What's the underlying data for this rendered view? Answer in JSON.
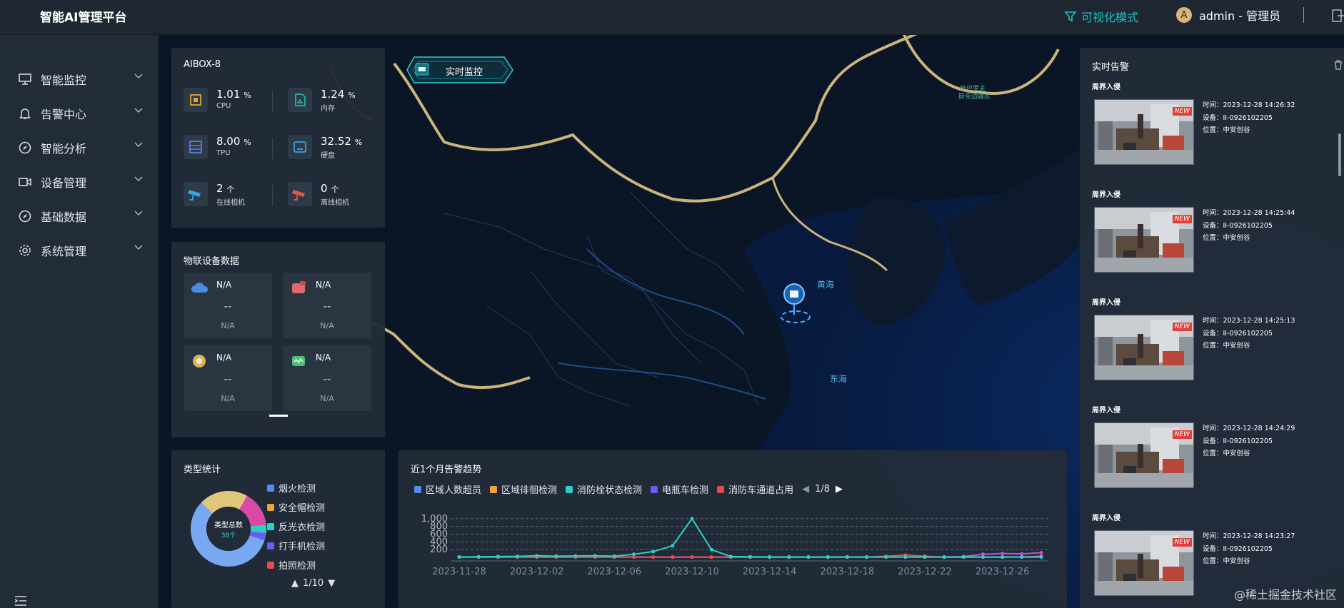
{
  "app": {
    "title": "智能AI管理平台",
    "mode_label": "可视化模式",
    "user_initial": "A",
    "user_label": "admin - 管理员"
  },
  "nav": [
    {
      "label": "智能监控",
      "icon": "monitor-icon"
    },
    {
      "label": "告警中心",
      "icon": "bell-icon"
    },
    {
      "label": "智能分析",
      "icon": "compass-icon"
    },
    {
      "label": "设备管理",
      "icon": "camera-icon"
    },
    {
      "label": "基础数据",
      "icon": "compass-icon"
    },
    {
      "label": "系统管理",
      "icon": "gear-icon"
    }
  ],
  "live_button": "实时监控",
  "map_labels": {
    "yellow_sea": "黄海",
    "east_sea": "东海",
    "border": "哈巴罗夫\n斯克边疆区"
  },
  "aibox": {
    "title": "AIBOX-8",
    "stats": [
      {
        "value": "1.01",
        "unit": "%",
        "label": "CPU",
        "icon": "cpu-icon",
        "color": "#e0a236"
      },
      {
        "value": "1.24",
        "unit": "%",
        "label": "内存",
        "icon": "memory-icon",
        "color": "#2bb39a"
      },
      {
        "value": "8.00",
        "unit": "%",
        "label": "TPU",
        "icon": "tpu-icon",
        "color": "#5b7fe6"
      },
      {
        "value": "32.52",
        "unit": "%",
        "label": "硬盘",
        "icon": "disk-icon",
        "color": "#3aa3e0"
      },
      {
        "value": "2",
        "unit": "个",
        "label": "在线相机",
        "icon": "online-camera-icon",
        "color": "#3aa3e0"
      },
      {
        "value": "0",
        "unit": "个",
        "label": "离线相机",
        "icon": "offline-camera-icon",
        "color": "#e05a4a"
      }
    ]
  },
  "iot": {
    "title": "物联设备数据",
    "cards": [
      {
        "name": "N/A",
        "value": "--",
        "sub": "N/A",
        "icon": "cloud-icon",
        "color": "#4a8be0"
      },
      {
        "name": "N/A",
        "value": "--",
        "sub": "N/A",
        "icon": "sensor-icon",
        "color": "#e06a6a"
      },
      {
        "name": "N/A",
        "value": "--",
        "sub": "N/A",
        "icon": "gauge-icon",
        "color": "#e0b15a"
      },
      {
        "name": "N/A",
        "value": "--",
        "sub": "N/A",
        "icon": "device-icon",
        "color": "#4cc07a"
      }
    ]
  },
  "types": {
    "title": "类型统计",
    "center_label": "类型总数",
    "center_value": "38个",
    "legend": [
      {
        "label": "烟火检测",
        "color": "#4d8ff2"
      },
      {
        "label": "安全帽检测",
        "color": "#f0a13a"
      },
      {
        "label": "反光衣检测",
        "color": "#2ad1c8"
      },
      {
        "label": "打手机检测",
        "color": "#6b5bf0"
      },
      {
        "label": "拍照检测",
        "color": "#e64a4a"
      }
    ],
    "pager": "1/10"
  },
  "trend": {
    "title": "近1个月告警趋势",
    "legend": [
      {
        "label": "区域人数超员",
        "color": "#4d8ff2"
      },
      {
        "label": "区域徘徊检测",
        "color": "#f0a13a"
      },
      {
        "label": "消防栓状态检测",
        "color": "#2ad1c8"
      },
      {
        "label": "电瓶车检测",
        "color": "#6b5bf0"
      },
      {
        "label": "消防车通道占用",
        "color": "#e64a4a"
      }
    ],
    "pager": "1/8"
  },
  "chart_data": {
    "type": "line",
    "title": "近1个月告警趋势",
    "x": [
      "2023-11-28",
      "2023-11-29",
      "2023-11-30",
      "2023-12-01",
      "2023-12-02",
      "2023-12-03",
      "2023-12-04",
      "2023-12-05",
      "2023-12-06",
      "2023-12-07",
      "2023-12-08",
      "2023-12-09",
      "2023-12-10",
      "2023-12-11",
      "2023-12-12",
      "2023-12-13",
      "2023-12-14",
      "2023-12-15",
      "2023-12-16",
      "2023-12-17",
      "2023-12-18",
      "2023-12-19",
      "2023-12-20",
      "2023-12-21",
      "2023-12-22",
      "2023-12-23",
      "2023-12-24",
      "2023-12-25",
      "2023-12-26",
      "2023-12-27",
      "2023-12-28"
    ],
    "xticks": [
      "2023-11-28",
      "2023-12-02",
      "2023-12-06",
      "2023-12-10",
      "2023-12-14",
      "2023-12-18",
      "2023-12-22",
      "2023-12-26"
    ],
    "yticks": [
      200,
      400,
      600,
      800,
      "1,000"
    ],
    "ylim": [
      0,
      1200
    ],
    "series": [
      {
        "color": "#2ad1c8",
        "values": [
          10,
          15,
          20,
          25,
          40,
          30,
          35,
          40,
          30,
          80,
          150,
          300,
          1000,
          200,
          20,
          15,
          10,
          10,
          10,
          10,
          10,
          10,
          10,
          10,
          10,
          10,
          10,
          10,
          10,
          10,
          10
        ]
      },
      {
        "color": "#e64a4a",
        "values": [
          5,
          5,
          5,
          5,
          5,
          5,
          5,
          5,
          5,
          5,
          5,
          5,
          5,
          5,
          5,
          5,
          5,
          5,
          5,
          5,
          5,
          5,
          30,
          60,
          30,
          5,
          5,
          5,
          5,
          10,
          30
        ]
      },
      {
        "color": "#c94fd6",
        "values": [
          10,
          10,
          10,
          10,
          10,
          10,
          10,
          10,
          10,
          10,
          10,
          10,
          10,
          10,
          10,
          10,
          10,
          10,
          10,
          10,
          10,
          10,
          10,
          10,
          10,
          10,
          20,
          80,
          100,
          90,
          120
        ]
      },
      {
        "color": "#6b5bf0",
        "values": [
          5,
          5,
          5,
          5,
          5,
          5,
          5,
          5,
          5,
          5,
          5,
          5,
          5,
          5,
          5,
          5,
          5,
          5,
          5,
          5,
          5,
          5,
          5,
          5,
          5,
          5,
          5,
          5,
          5,
          5,
          5
        ]
      }
    ]
  },
  "alerts": {
    "title": "实时告警",
    "items": [
      {
        "type": "周界入侵",
        "time": "时间：2023-12-28 14:26:32",
        "device": "设备：II-0926102205",
        "location": "位置：中安创谷",
        "badge": "NEW"
      },
      {
        "type": "周界入侵",
        "time": "时间：2023-12-28 14:25:44",
        "device": "设备：II-0926102205",
        "location": "位置：中安创谷",
        "badge": "NEW"
      },
      {
        "type": "周界入侵",
        "time": "时间：2023-12-28 14:25:13",
        "device": "设备：II-0926102205",
        "location": "位置：中安创谷",
        "badge": "NEW"
      },
      {
        "type": "周界入侵",
        "time": "时间：2023-12-28 14:24:29",
        "device": "设备：II-0926102205",
        "location": "位置：中安创谷",
        "badge": "NEW"
      },
      {
        "type": "周界入侵",
        "time": "时间：2023-12-28 14:23:27",
        "device": "设备：II-0926102205",
        "location": "位置：中安创谷",
        "badge": "NEW"
      }
    ]
  },
  "watermark": "@稀土掘金技术社区"
}
